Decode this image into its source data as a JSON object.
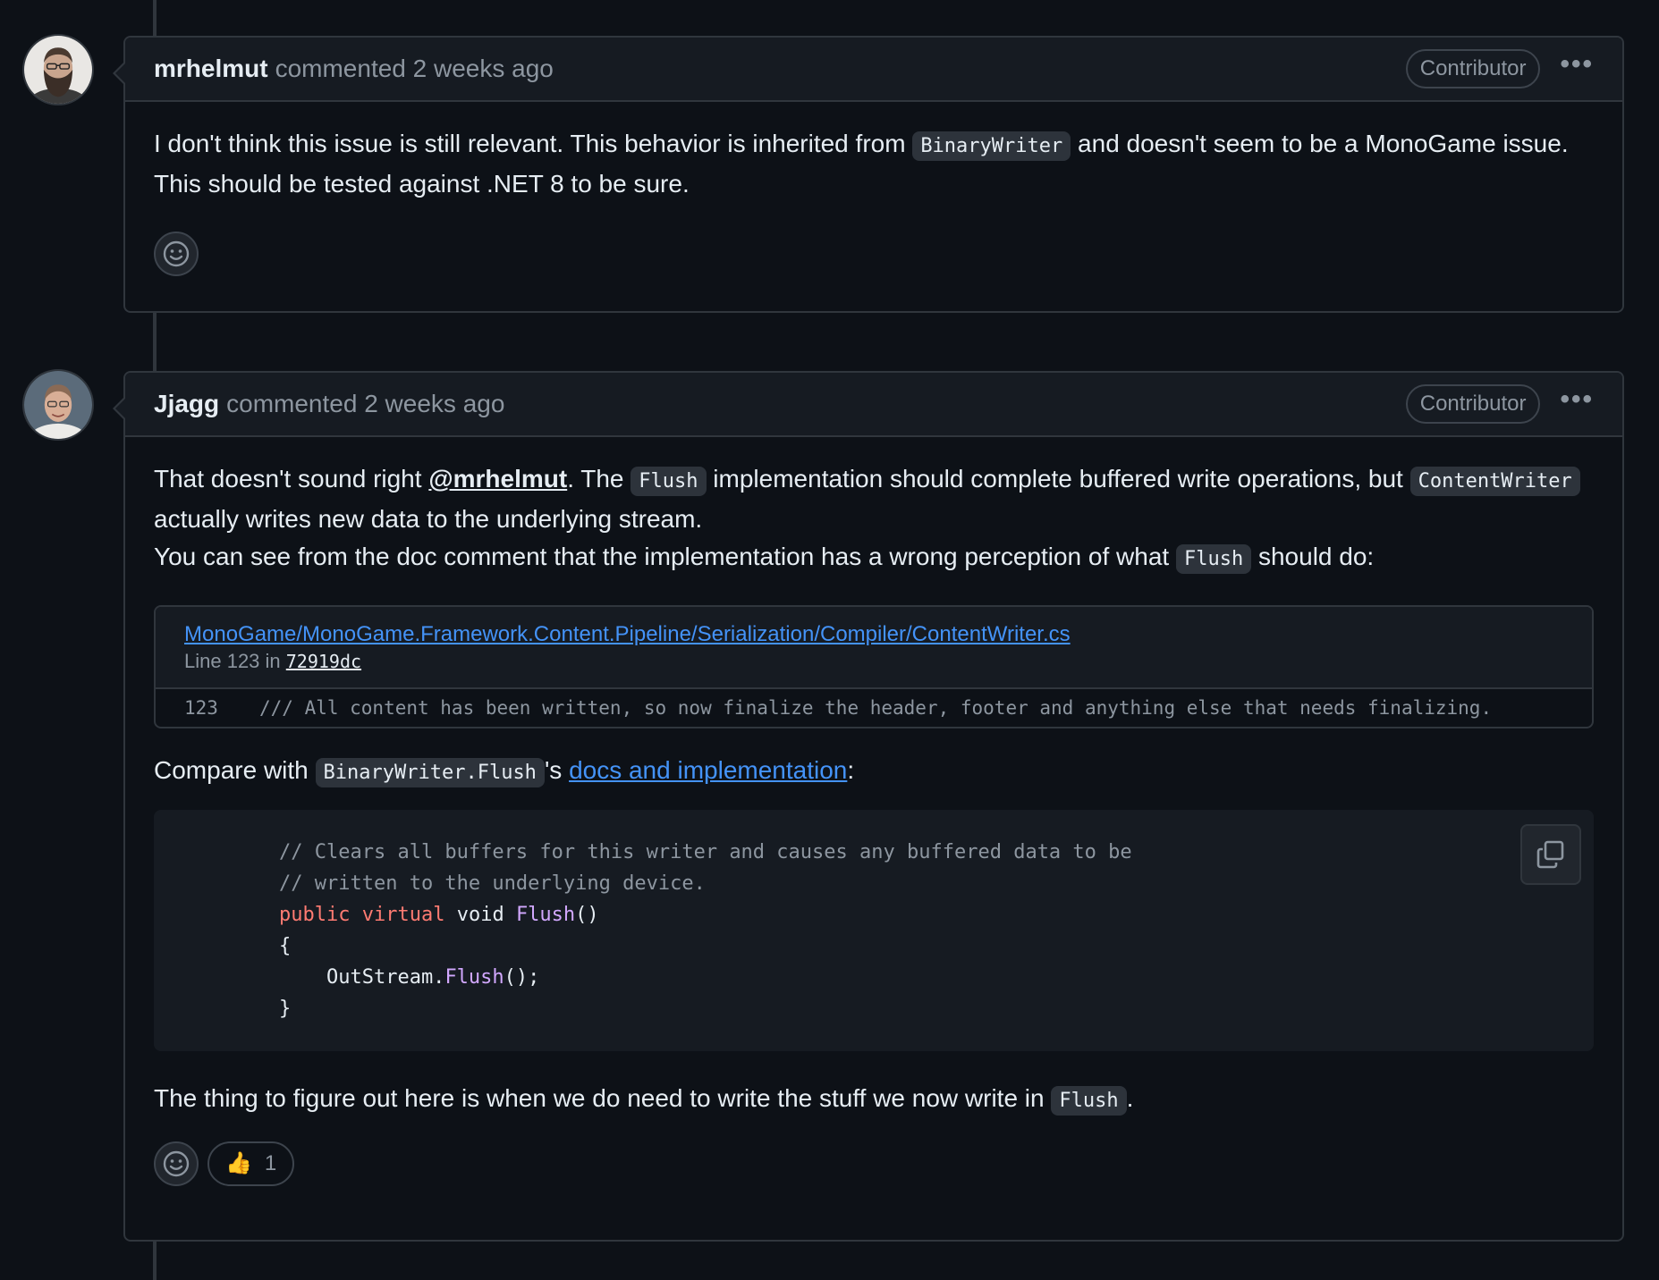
{
  "comments": [
    {
      "author": "mrhelmut",
      "meta": "commented 2 weeks ago",
      "badge": "Contributor",
      "more": "•••",
      "body": {
        "t1": "I don't think this issue is still relevant. This behavior is inherited from ",
        "code1": "BinaryWriter",
        "t2": " and doesn't seem to be a MonoGame issue.",
        "t3": "This should be tested against .NET 8 to be sure."
      },
      "reactions": {
        "add_icon": "smiley-icon"
      }
    },
    {
      "author": "Jjagg",
      "meta": "commented 2 weeks ago",
      "badge": "Contributor",
      "more": "•••",
      "body": {
        "p1_t1": "That doesn't sound right ",
        "p1_mention": "@mrhelmut",
        "p1_t2": ". The ",
        "p1_code1": "Flush",
        "p1_t3": " implementation should complete buffered write operations, but ",
        "p1_code2": "ContentWriter",
        "p1_t4": "actually writes new data to the underlying stream.",
        "p2_t1": "You can see from the doc comment that the implementation has a wrong perception of what ",
        "p2_code": "Flush",
        "p2_t2": " should do:",
        "permalink": {
          "path": "MonoGame/MonoGame.Framework.Content.Pipeline/Serialization/Compiler/ContentWriter.cs",
          "sub_prefix": "Line 123 in ",
          "sha": "72919dc",
          "line_number": "123",
          "line_code": "/// All content has been written, so now finalize the header, footer and anything else that needs finalizing."
        },
        "p3_t1": "Compare with ",
        "p3_code": "BinaryWriter.Flush",
        "p3_t2": "'s ",
        "p3_link": "docs and implementation",
        "p3_t3": ":",
        "code": {
          "l1": "// Clears all buffers for this writer and causes any buffered data to be",
          "l2": "// written to the underlying device.",
          "l3_kw1": "public",
          "l3_kw2": "virtual",
          "l3_type": "void",
          "l3_fn": "Flush",
          "l3_paren": "()",
          "l4": "{",
          "l5_obj": "    OutStream.",
          "l5_fn": "Flush",
          "l5_end": "();",
          "l6": "}"
        },
        "p4_t1": "The thing to figure out here is when we do need to write the stuff we now write in ",
        "p4_code": "Flush",
        "p4_t2": "."
      },
      "reactions": {
        "add_icon": "smiley-icon",
        "thumbs_emoji": "👍",
        "thumbs_count": "1"
      }
    }
  ],
  "colors": {
    "background": "#0d1117",
    "link": "#4493f8",
    "keyword": "#ff7b72",
    "function": "#d2a8ff"
  }
}
